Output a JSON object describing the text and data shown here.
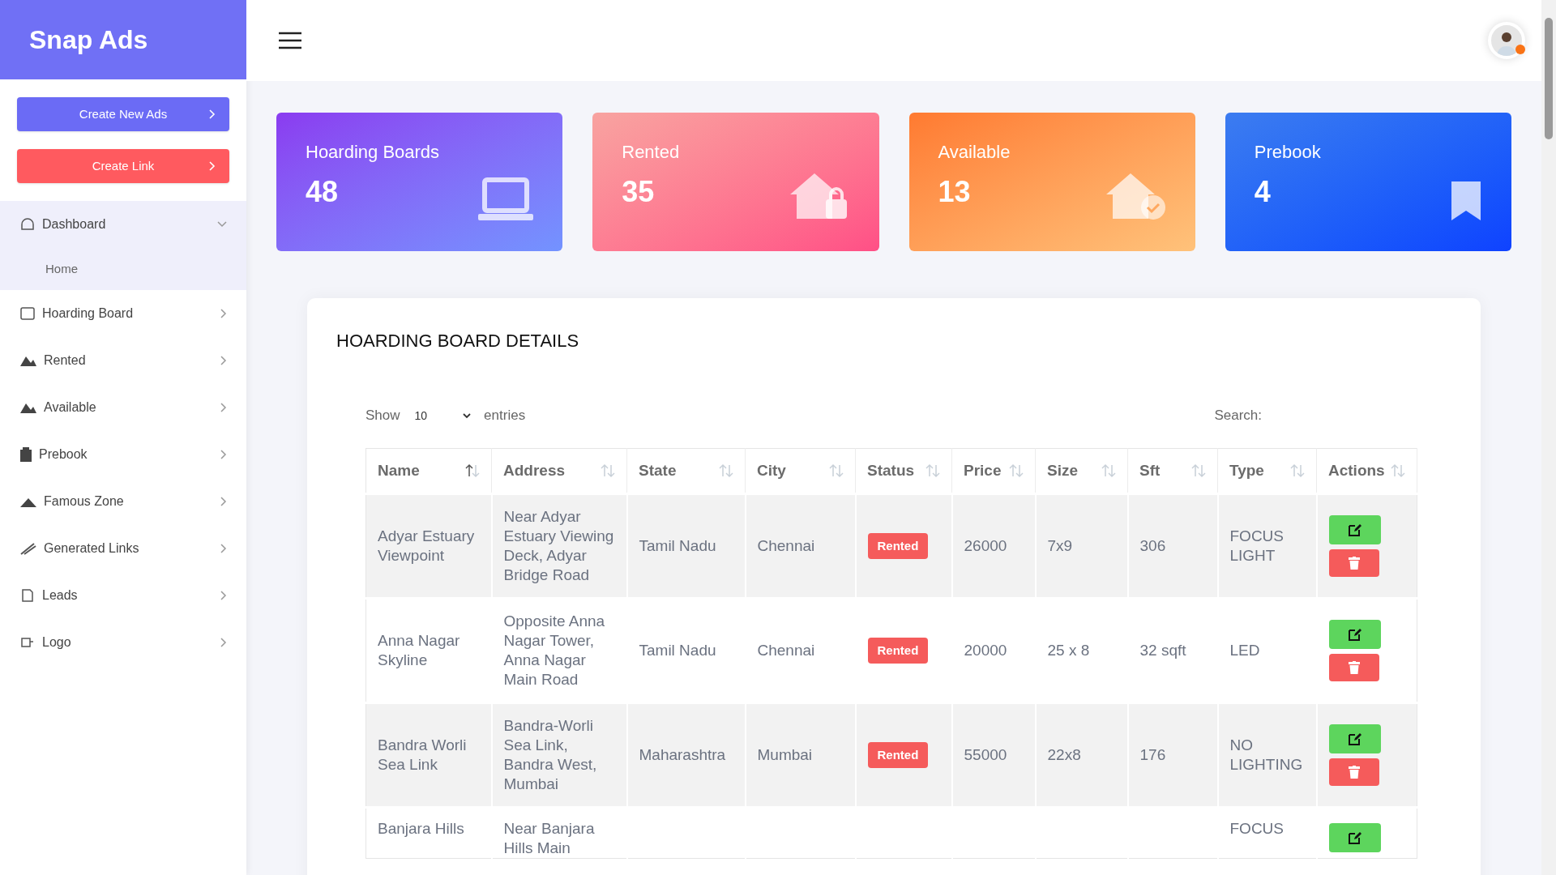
{
  "sidebar": {
    "logo": "Snap Ads",
    "buttons": [
      {
        "label": "Create New Ads",
        "kind": "primary"
      },
      {
        "label": "Create Link",
        "kind": "danger"
      }
    ],
    "items": [
      {
        "label": "Dashboard",
        "expanded": true,
        "children": [
          {
            "label": "Home"
          }
        ]
      },
      {
        "label": "Hoarding Board",
        "expanded": false
      },
      {
        "label": "Rented",
        "expanded": false
      },
      {
        "label": "Available",
        "expanded": false
      },
      {
        "label": "Prebook",
        "expanded": false
      },
      {
        "label": "Famous Zone",
        "expanded": false
      },
      {
        "label": "Generated Links",
        "expanded": false
      },
      {
        "label": "Leads",
        "expanded": false
      },
      {
        "label": "Logo",
        "expanded": false
      }
    ]
  },
  "stats": [
    {
      "title": "Hoarding Boards",
      "value": "48",
      "kind": "laptop"
    },
    {
      "title": "Rented",
      "value": "35",
      "kind": "locked-house"
    },
    {
      "title": "Available",
      "value": "13",
      "kind": "checked-house"
    },
    {
      "title": "Prebook",
      "value": "4",
      "kind": "bookmark"
    }
  ],
  "table_card": {
    "title": "HOARDING BOARD DETAILS",
    "show_label": "Show",
    "page_size": "10",
    "entries_label": "entries",
    "search_label": "Search:",
    "columns": [
      {
        "label": "Name",
        "sorted": true
      },
      {
        "label": "Address",
        "sorted": false
      },
      {
        "label": "State",
        "sorted": false
      },
      {
        "label": "City",
        "sorted": false
      },
      {
        "label": "Status",
        "sorted": false
      },
      {
        "label": "Price",
        "sorted": false
      },
      {
        "label": "Size",
        "sorted": false
      },
      {
        "label": "Sft",
        "sorted": false
      },
      {
        "label": "Type",
        "sorted": false
      },
      {
        "label": "Actions",
        "sorted": false
      }
    ],
    "rows": [
      {
        "cells": [
          "Adyar Estuary Viewpoint",
          "Near Adyar Estuary Viewing Deck, Adyar Bridge Road",
          "Tamil Nadu",
          "Chennai",
          "Rented",
          "26000",
          "7x9",
          "306",
          "FOCUS LIGHT"
        ],
        "actions": [
          {
            "kind": "edit"
          },
          {
            "kind": "delete"
          }
        ]
      },
      {
        "cells": [
          "Anna Nagar Skyline",
          "Opposite Anna Nagar Tower, Anna Nagar Main Road",
          "Tamil Nadu",
          "Chennai",
          "Rented",
          "20000",
          "25 x 8",
          "32 sqft",
          "LED"
        ],
        "actions": [
          {
            "kind": "edit"
          },
          {
            "kind": "delete"
          }
        ]
      },
      {
        "cells": [
          "Bandra Worli Sea Link",
          "Bandra-Worli Sea Link, Bandra West, Mumbai",
          "Maharashtra",
          "Mumbai",
          "Rented",
          "55000",
          "22x8",
          "176",
          "NO LIGHTING"
        ],
        "actions": [
          {
            "kind": "edit"
          },
          {
            "kind": "delete"
          }
        ]
      },
      {
        "cells": [
          "Banjara Hills",
          "Near Banjara Hills Main",
          null,
          null,
          null,
          null,
          null,
          null,
          "FOCUS"
        ],
        "actions": [
          {
            "kind": "edit"
          }
        ]
      }
    ]
  }
}
